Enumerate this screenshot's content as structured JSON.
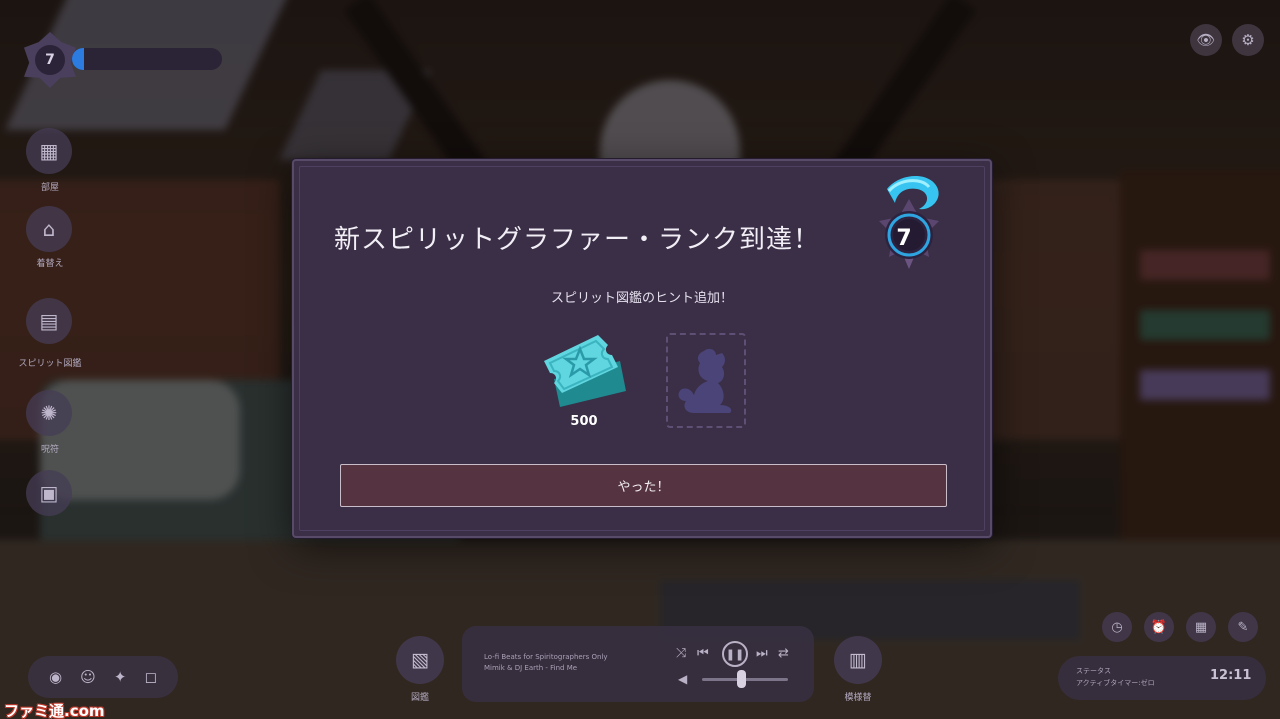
{
  "hud": {
    "rank_level": "7",
    "xp_progress_fraction": 0.08,
    "side_menu": [
      {
        "label": "部屋",
        "icon": "bed-icon"
      },
      {
        "label": "着替え",
        "icon": "hanger-icon"
      },
      {
        "label": "スピリット図鑑",
        "icon": "journal-icon"
      },
      {
        "label": "呪符",
        "icon": "spirit-icon"
      },
      {
        "label": "",
        "icon": "photo-icon"
      }
    ],
    "top_right": [
      "eye-icon",
      "gear-icon"
    ],
    "social": [
      "steam-icon",
      "discord-icon",
      "twitter-icon",
      "instagram-icon"
    ],
    "bottom_left_button": {
      "label": "図鑑",
      "icon": "notebook-icon"
    },
    "bottom_right_button": {
      "label": "模様替",
      "icon": "shop-icon"
    },
    "tools": [
      "timer-icon",
      "alarm-icon",
      "calendar-icon",
      "notes-icon"
    ]
  },
  "music_player": {
    "track_line1": "Lo-fi Beats for Spiritographers Only",
    "track_line2": "Mimik & DJ Earth - Find Me",
    "controls": [
      "shuffle-icon",
      "previous-icon",
      "pause-icon",
      "next-icon",
      "repeat-icon"
    ],
    "volume_fraction": 0.45
  },
  "status": {
    "line1": "ステータス",
    "line2": "アクティブタイマー:ゼロ",
    "clock": "12:11"
  },
  "watermark": "ファミ通.com",
  "modal": {
    "title": "新スピリットグラファー・ランク到達！",
    "rank": "7",
    "subtitle": "スピリット図鑑のヒント追加！",
    "reward_amount": "500",
    "confirm_label": "やった！",
    "colors": {
      "panel": "#3a2f46",
      "button": "#553340",
      "ticket": "#5fd6e0",
      "silhouette": "#4a4478"
    }
  }
}
